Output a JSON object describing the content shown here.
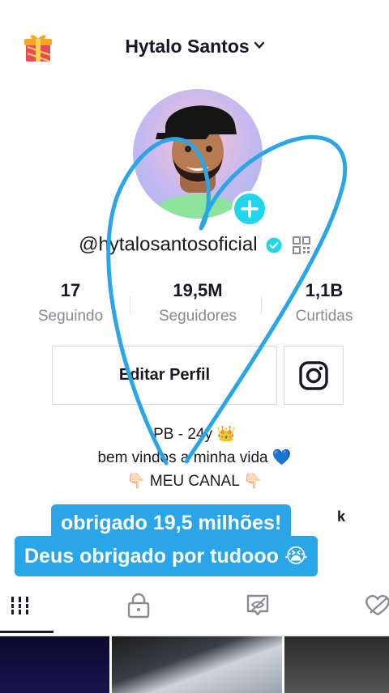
{
  "header": {
    "title": "Hytalo Santos",
    "gift_icon": "gift-icon",
    "chevron_icon": "chevron-down-icon"
  },
  "profile": {
    "username": "@hytalosantosoficial",
    "verified_icon": "verified-badge-icon",
    "qr_icon": "qr-code-icon",
    "stats": [
      {
        "value": "17",
        "label": "Seguindo"
      },
      {
        "value": "19,5M",
        "label": "Seguidores"
      },
      {
        "value": "1,1B",
        "label": "Curtidas"
      }
    ],
    "edit_button": "Editar Perfil",
    "instagram_icon": "instagram-icon",
    "bio": [
      "PB - 24y 👑",
      "bem vindos a minha vida 💙",
      "👇🏻 MEU CANAL 👇🏻"
    ],
    "link_fragment": "k"
  },
  "overlay": {
    "caption_line1": "obrigado 19,5 milhões!",
    "caption_line2": "Deus obrigado por tudooo 😭",
    "accent_color": "#2aa6e8"
  },
  "tabs": [
    {
      "icon": "grid-icon",
      "active": true
    },
    {
      "icon": "lock-icon",
      "active": false
    },
    {
      "icon": "hidden-video-icon",
      "active": false
    },
    {
      "icon": "liked-hidden-icon",
      "active": false
    }
  ],
  "colors": {
    "add_button": "#20d5ec",
    "verified": "#20d5ec",
    "text": "#161823",
    "muted": "#8a8b91"
  }
}
